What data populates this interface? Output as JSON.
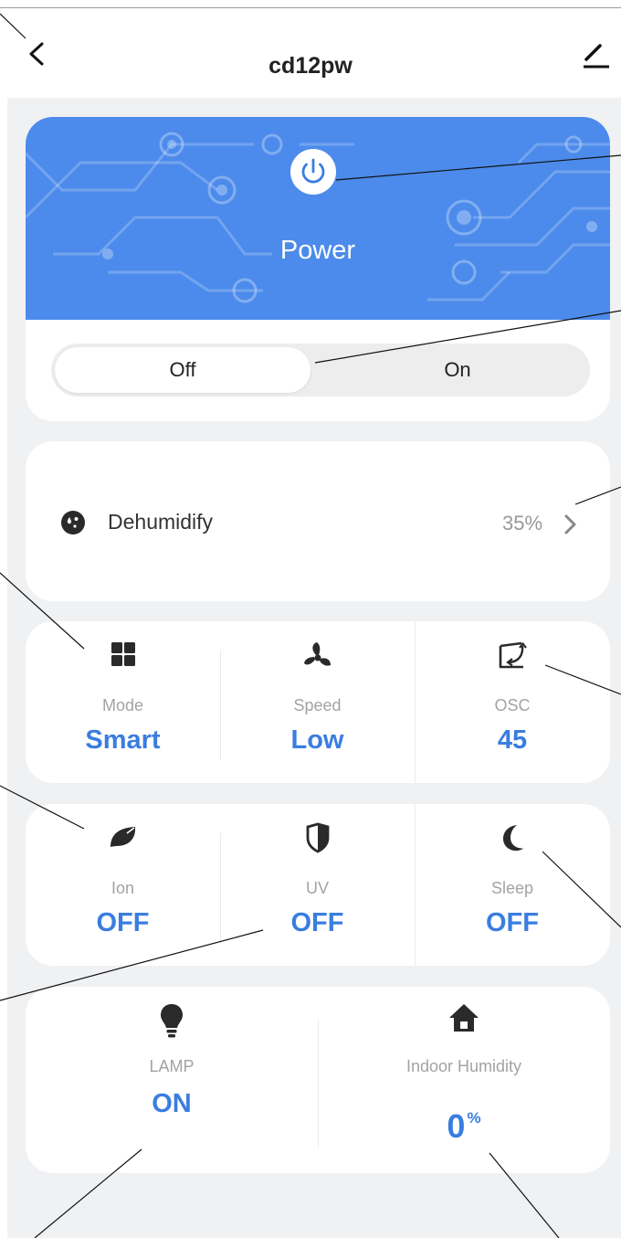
{
  "header": {
    "title": "cd12pw",
    "back_icon": "chevron-left-icon",
    "edit_icon": "pencil-icon"
  },
  "power": {
    "title": "Power",
    "icon": "power-icon",
    "toggle": {
      "off_label": "Off",
      "on_label": "On",
      "selected": "Off"
    }
  },
  "dehumidify": {
    "icon": "water-drop-icon",
    "label": "Dehumidify",
    "value": "35%",
    "chevron_icon": "chevron-right-icon"
  },
  "controls_row1": [
    {
      "icon": "grid-icon",
      "label": "Mode",
      "value": "Smart"
    },
    {
      "icon": "fan-icon",
      "label": "Speed",
      "value": "Low"
    },
    {
      "icon": "oscillate-icon",
      "label": "OSC",
      "value": "45"
    }
  ],
  "controls_row2": [
    {
      "icon": "leaf-icon",
      "label": "Ion",
      "value": "OFF"
    },
    {
      "icon": "shield-icon",
      "label": "UV",
      "value": "OFF"
    },
    {
      "icon": "moon-icon",
      "label": "Sleep",
      "value": "OFF"
    }
  ],
  "controls_row3": {
    "lamp": {
      "icon": "lightbulb-icon",
      "label": "LAMP",
      "value": "ON"
    },
    "humidity": {
      "icon": "home-icon",
      "label": "Indoor Humidity",
      "value": "0",
      "unit": "%"
    }
  },
  "colors": {
    "accent": "#3a7de0",
    "banner": "#4c8beb",
    "background": "#f0f1f3",
    "label_gray": "#a3a3a3"
  }
}
